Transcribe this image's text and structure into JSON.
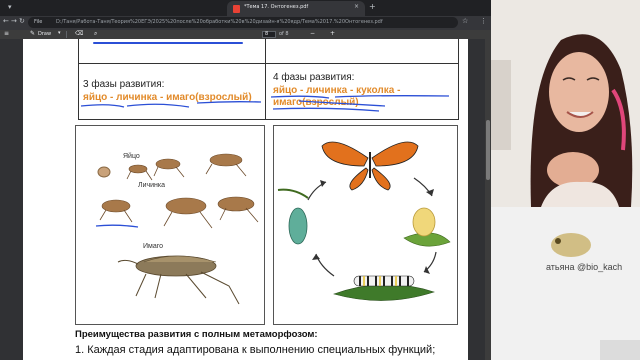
{
  "browser": {
    "tab_title": "*Тема 17. Онтогенез.pdf",
    "tab_close": "×",
    "new_tab": "+",
    "back": "←",
    "forward": "→",
    "reload": "↻",
    "file_label": "File",
    "url": "D:/Таня/Работа-Таня/Теория%20ЕГЭ/2025%20после%20обработки%20в%20дизайн-я%20ядр/Тема%2017.%20Онтогенез.pdf",
    "bookmark": "☆",
    "menu": "⋮"
  },
  "pdf_toolbar": {
    "draw_label": "Draw",
    "page_current": "8",
    "page_total": "of 8",
    "zoom_out": "−",
    "zoom_in": "+"
  },
  "document": {
    "phase3_title": "3 фазы развития:",
    "phase3_stages": "яйцо - личинка - имаго(взрослый)",
    "phase4_title": "4 фазы развития:",
    "phase4_stages_line1": "яйцо - личинка - куколка -",
    "phase4_stages_line2": "имаго(взрослый)",
    "label_egg": "Яйцо",
    "label_larva": "Личинка",
    "label_imago": "Имаго",
    "advantages_title": "Преимущества развития с полным метаморфозом:",
    "advantages_item1": "1. Каждая стадия адаптирована к выполнению специальных функций;"
  },
  "webcam": {
    "handle": "атьяна @bio_kach"
  },
  "colors": {
    "accent_orange": "#e28b2b",
    "annotation_blue": "#2b4fd6"
  }
}
